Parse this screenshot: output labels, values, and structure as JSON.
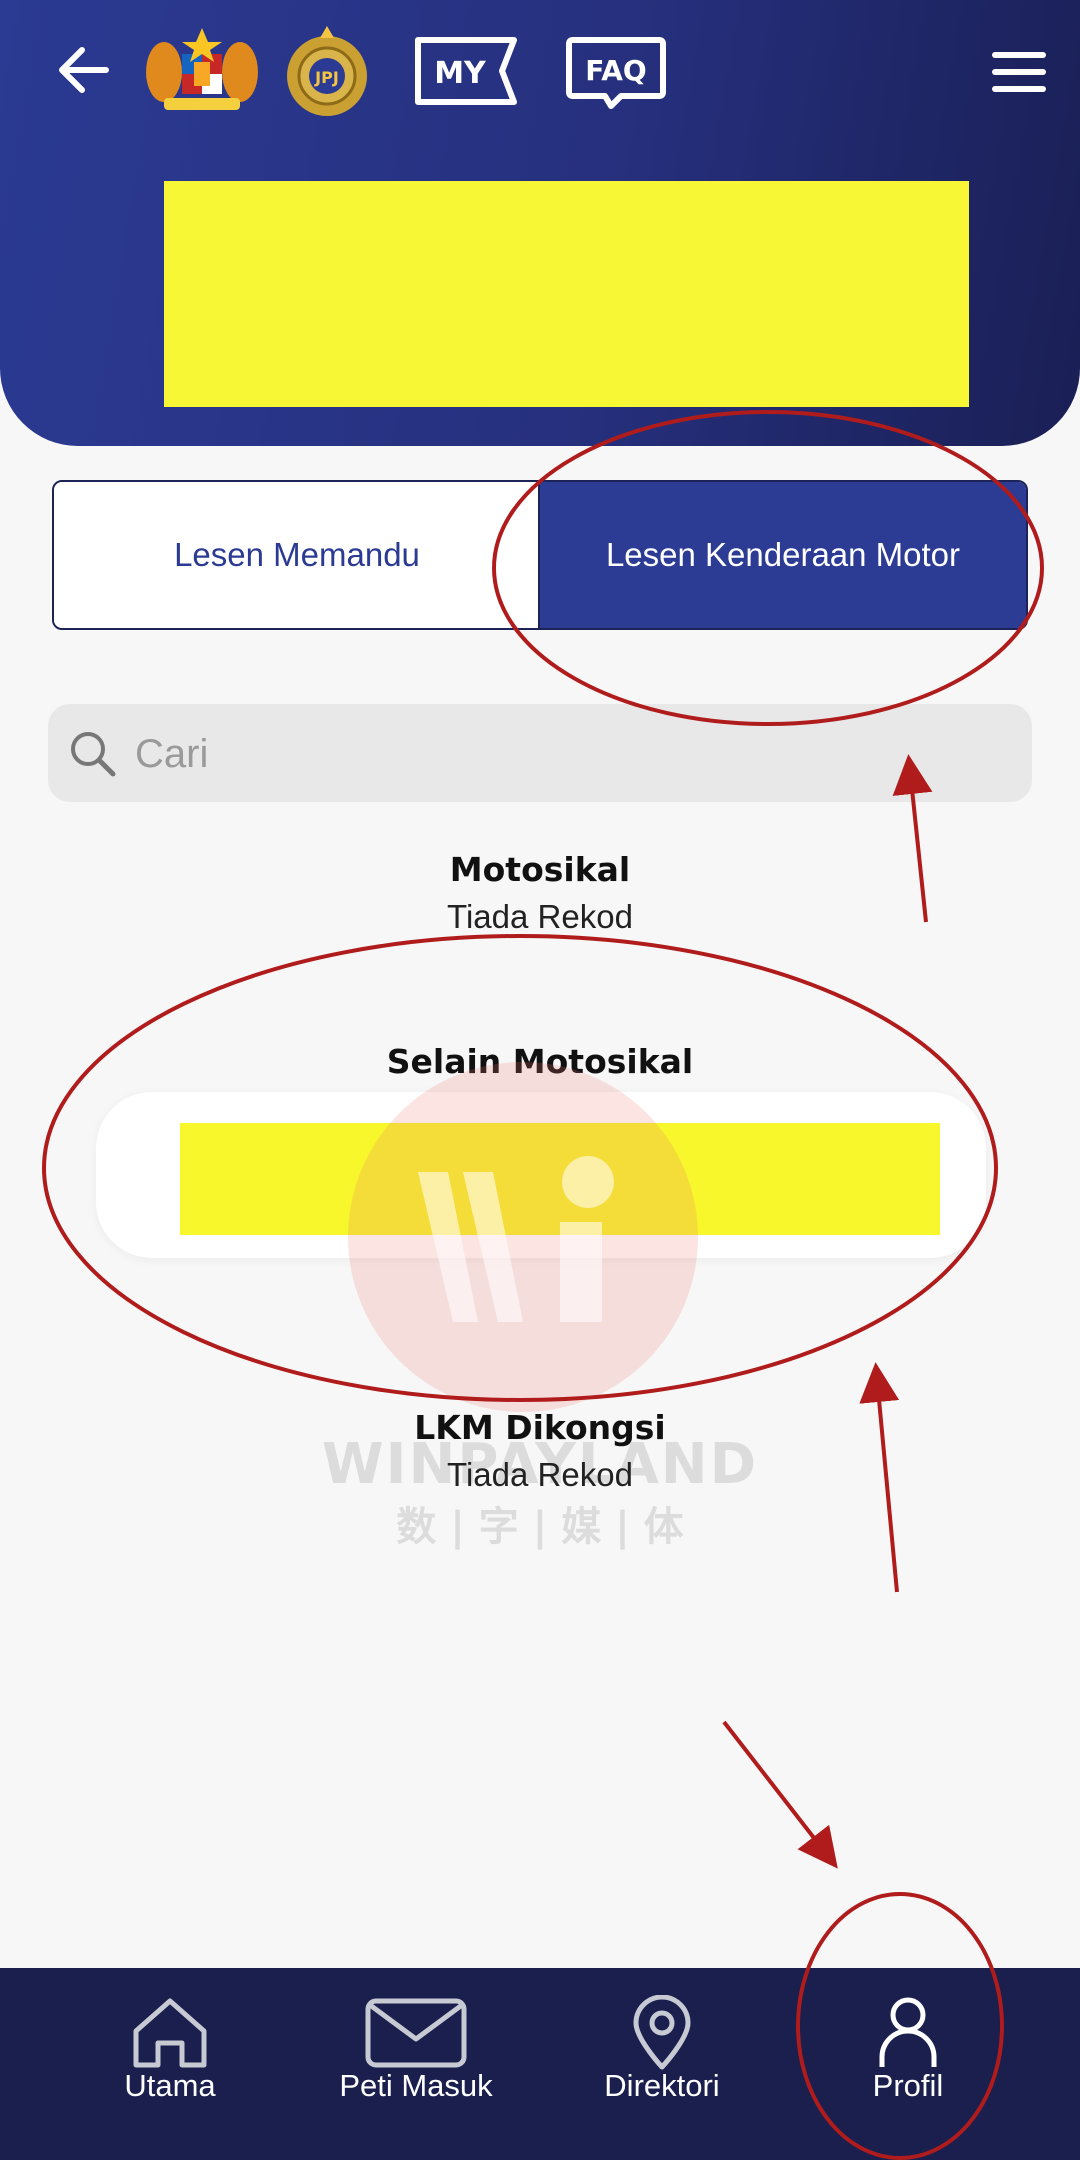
{
  "header": {
    "back_icon": "arrow-left-icon",
    "logos": [
      "malaysia-coat-of-arms-logo",
      "jpj-emblem-logo"
    ],
    "my_badge": "MY",
    "faq_badge": "FAQ",
    "menu_icon": "hamburger-menu-icon"
  },
  "tabs": [
    {
      "label": "Lesen Memandu",
      "active": false
    },
    {
      "label": "Lesen Kenderaan Motor",
      "active": true
    }
  ],
  "search": {
    "placeholder": "Cari",
    "icon": "search-icon"
  },
  "sections": {
    "motosikal": {
      "title": "Motosikal",
      "status": "Tiada Rekod"
    },
    "selain": {
      "title": "Selain Motosikal"
    },
    "lkm": {
      "title": "LKM Dikongsi",
      "status": "Tiada Rekod"
    }
  },
  "watermark": {
    "brand": "WINPAYLAND",
    "sub": "数 | 字 | 媒 | 体"
  },
  "bottom_nav": [
    {
      "label": "Utama",
      "icon": "home-icon"
    },
    {
      "label": "Peti Masuk",
      "icon": "mail-icon"
    },
    {
      "label": "Direktori",
      "icon": "location-pin-icon"
    },
    {
      "label": "Profil",
      "icon": "person-icon"
    }
  ],
  "colors": {
    "header_blue": "#2b3a92",
    "nav_dark": "#1a1f4e",
    "annotation_red": "#b01c1c",
    "redaction_yellow": "#f7f735"
  }
}
